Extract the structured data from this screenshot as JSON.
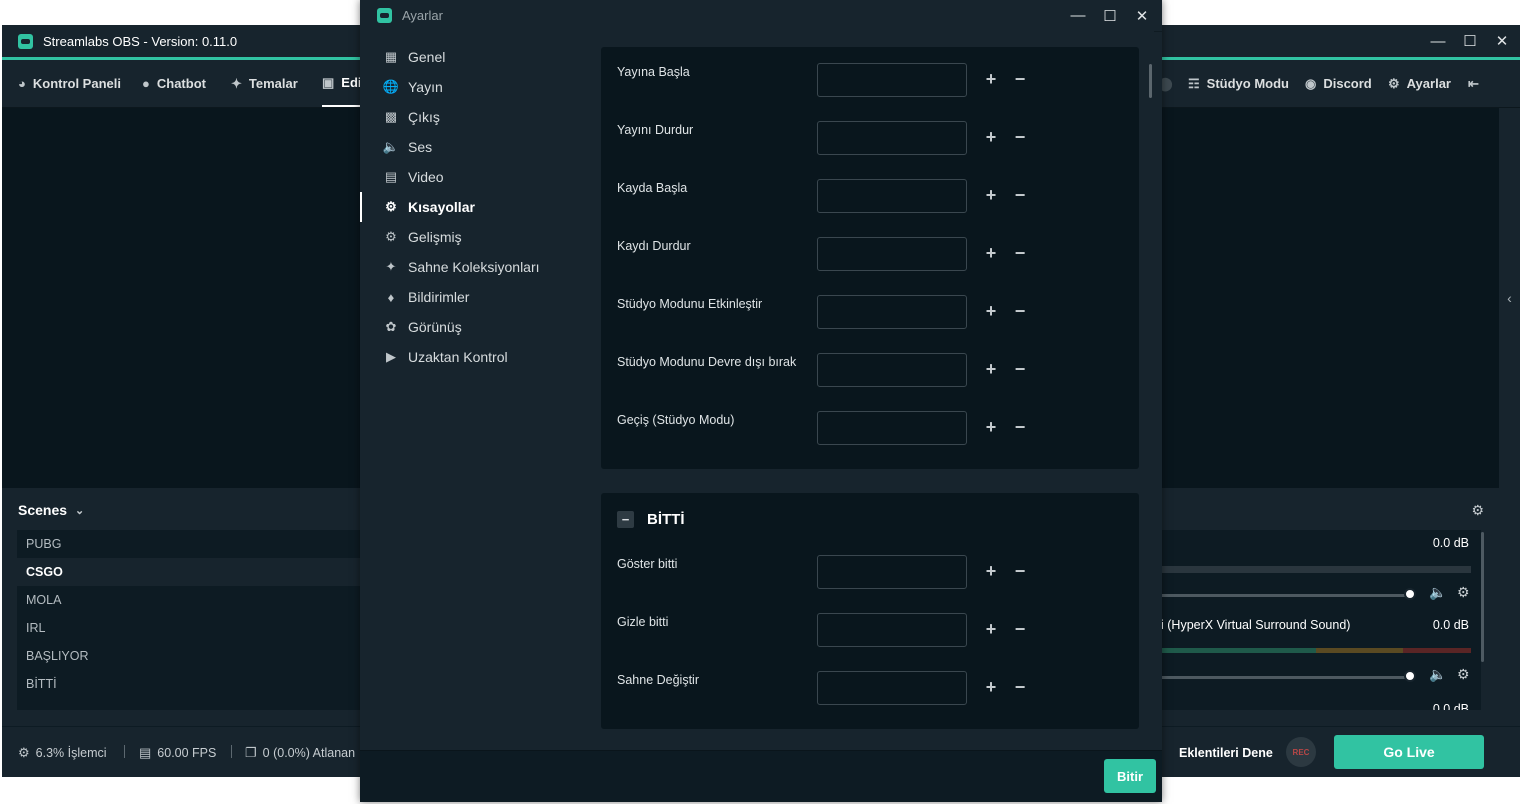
{
  "main_window": {
    "title": "Streamlabs OBS - Version: 0.11.0",
    "nav_left": [
      {
        "label": "Kontrol Paneli",
        "icon": "dashboard-icon"
      },
      {
        "label": "Chatbot",
        "icon": "chat-bubble-icon"
      },
      {
        "label": "Temalar",
        "icon": "magic-wand-icon"
      },
      {
        "label": "Edi",
        "icon": "video-camera-icon"
      }
    ],
    "nav_right": [
      {
        "label": "Stüdyo Modu",
        "icon": "studio-mode-icon"
      },
      {
        "label": "Discord",
        "icon": "discord-icon"
      },
      {
        "label": "Ayarlar",
        "icon": "gear-icon"
      }
    ],
    "scenes": {
      "header": "Scenes",
      "items": [
        "PUBG",
        "CSGO",
        "MOLA",
        "IRL",
        "BAŞLIYOR",
        "BİTTİ"
      ],
      "selected": "CSGO"
    },
    "mixer": {
      "sources": [
        {
          "name": "",
          "db": "0.0 dB",
          "volume": 1.0
        },
        {
          "name": "i (HyperX Virtual Surround Sound)",
          "db": "0.0 dB",
          "volume": 1.0
        },
        {
          "name": "",
          "db": "0.0 dB",
          "volume": 1.0
        }
      ]
    },
    "footer": {
      "cpu": "6.3% İşlemci",
      "fps": "60.00 FPS",
      "dropped": "0 (0.0%) Atlanan",
      "try_plugins": "Eklentileri Dene",
      "rec": "REC",
      "go_live": "Go Live"
    }
  },
  "dialog": {
    "title": "Ayarlar",
    "menu": [
      {
        "label": "Genel",
        "icon": "grid-icon"
      },
      {
        "label": "Yayın",
        "icon": "globe-icon"
      },
      {
        "label": "Çıkış",
        "icon": "chip-icon"
      },
      {
        "label": "Ses",
        "icon": "speaker-icon"
      },
      {
        "label": "Video",
        "icon": "film-icon"
      },
      {
        "label": "Kısayollar",
        "icon": "gear-icon"
      },
      {
        "label": "Gelişmiş",
        "icon": "gears-icon"
      },
      {
        "label": "Sahne Koleksiyonları",
        "icon": "magic-wand-icon"
      },
      {
        "label": "Bildirimler",
        "icon": "bell-icon"
      },
      {
        "label": "Görünüş",
        "icon": "palette-icon"
      },
      {
        "label": "Uzaktan Kontrol",
        "icon": "play-circle-icon"
      }
    ],
    "active_menu": "Kısayollar",
    "hotkeys_general": [
      {
        "label": "Yayına Başla",
        "value": ""
      },
      {
        "label": "Yayını Durdur",
        "value": ""
      },
      {
        "label": "Kayda Başla",
        "value": ""
      },
      {
        "label": "Kaydı Durdur",
        "value": ""
      },
      {
        "label": "Stüdyo Modunu Etkinleştir",
        "value": ""
      },
      {
        "label": "Stüdyo Modunu Devre dışı bırak",
        "value": ""
      },
      {
        "label": "Geçiş (Stüdyo Modu)",
        "value": ""
      }
    ],
    "section_bitti": {
      "title": "BİTTİ",
      "collapse_symbol": "−",
      "hotkeys": [
        {
          "label": "Göster bitti",
          "value": ""
        },
        {
          "label": "Gizle bitti",
          "value": ""
        },
        {
          "label": "Sahne Değiştir",
          "value": ""
        }
      ]
    },
    "done": "Bitir"
  },
  "colors": {
    "accent": "#31c3a2",
    "panel": "#17242d",
    "background": "#09161d"
  }
}
